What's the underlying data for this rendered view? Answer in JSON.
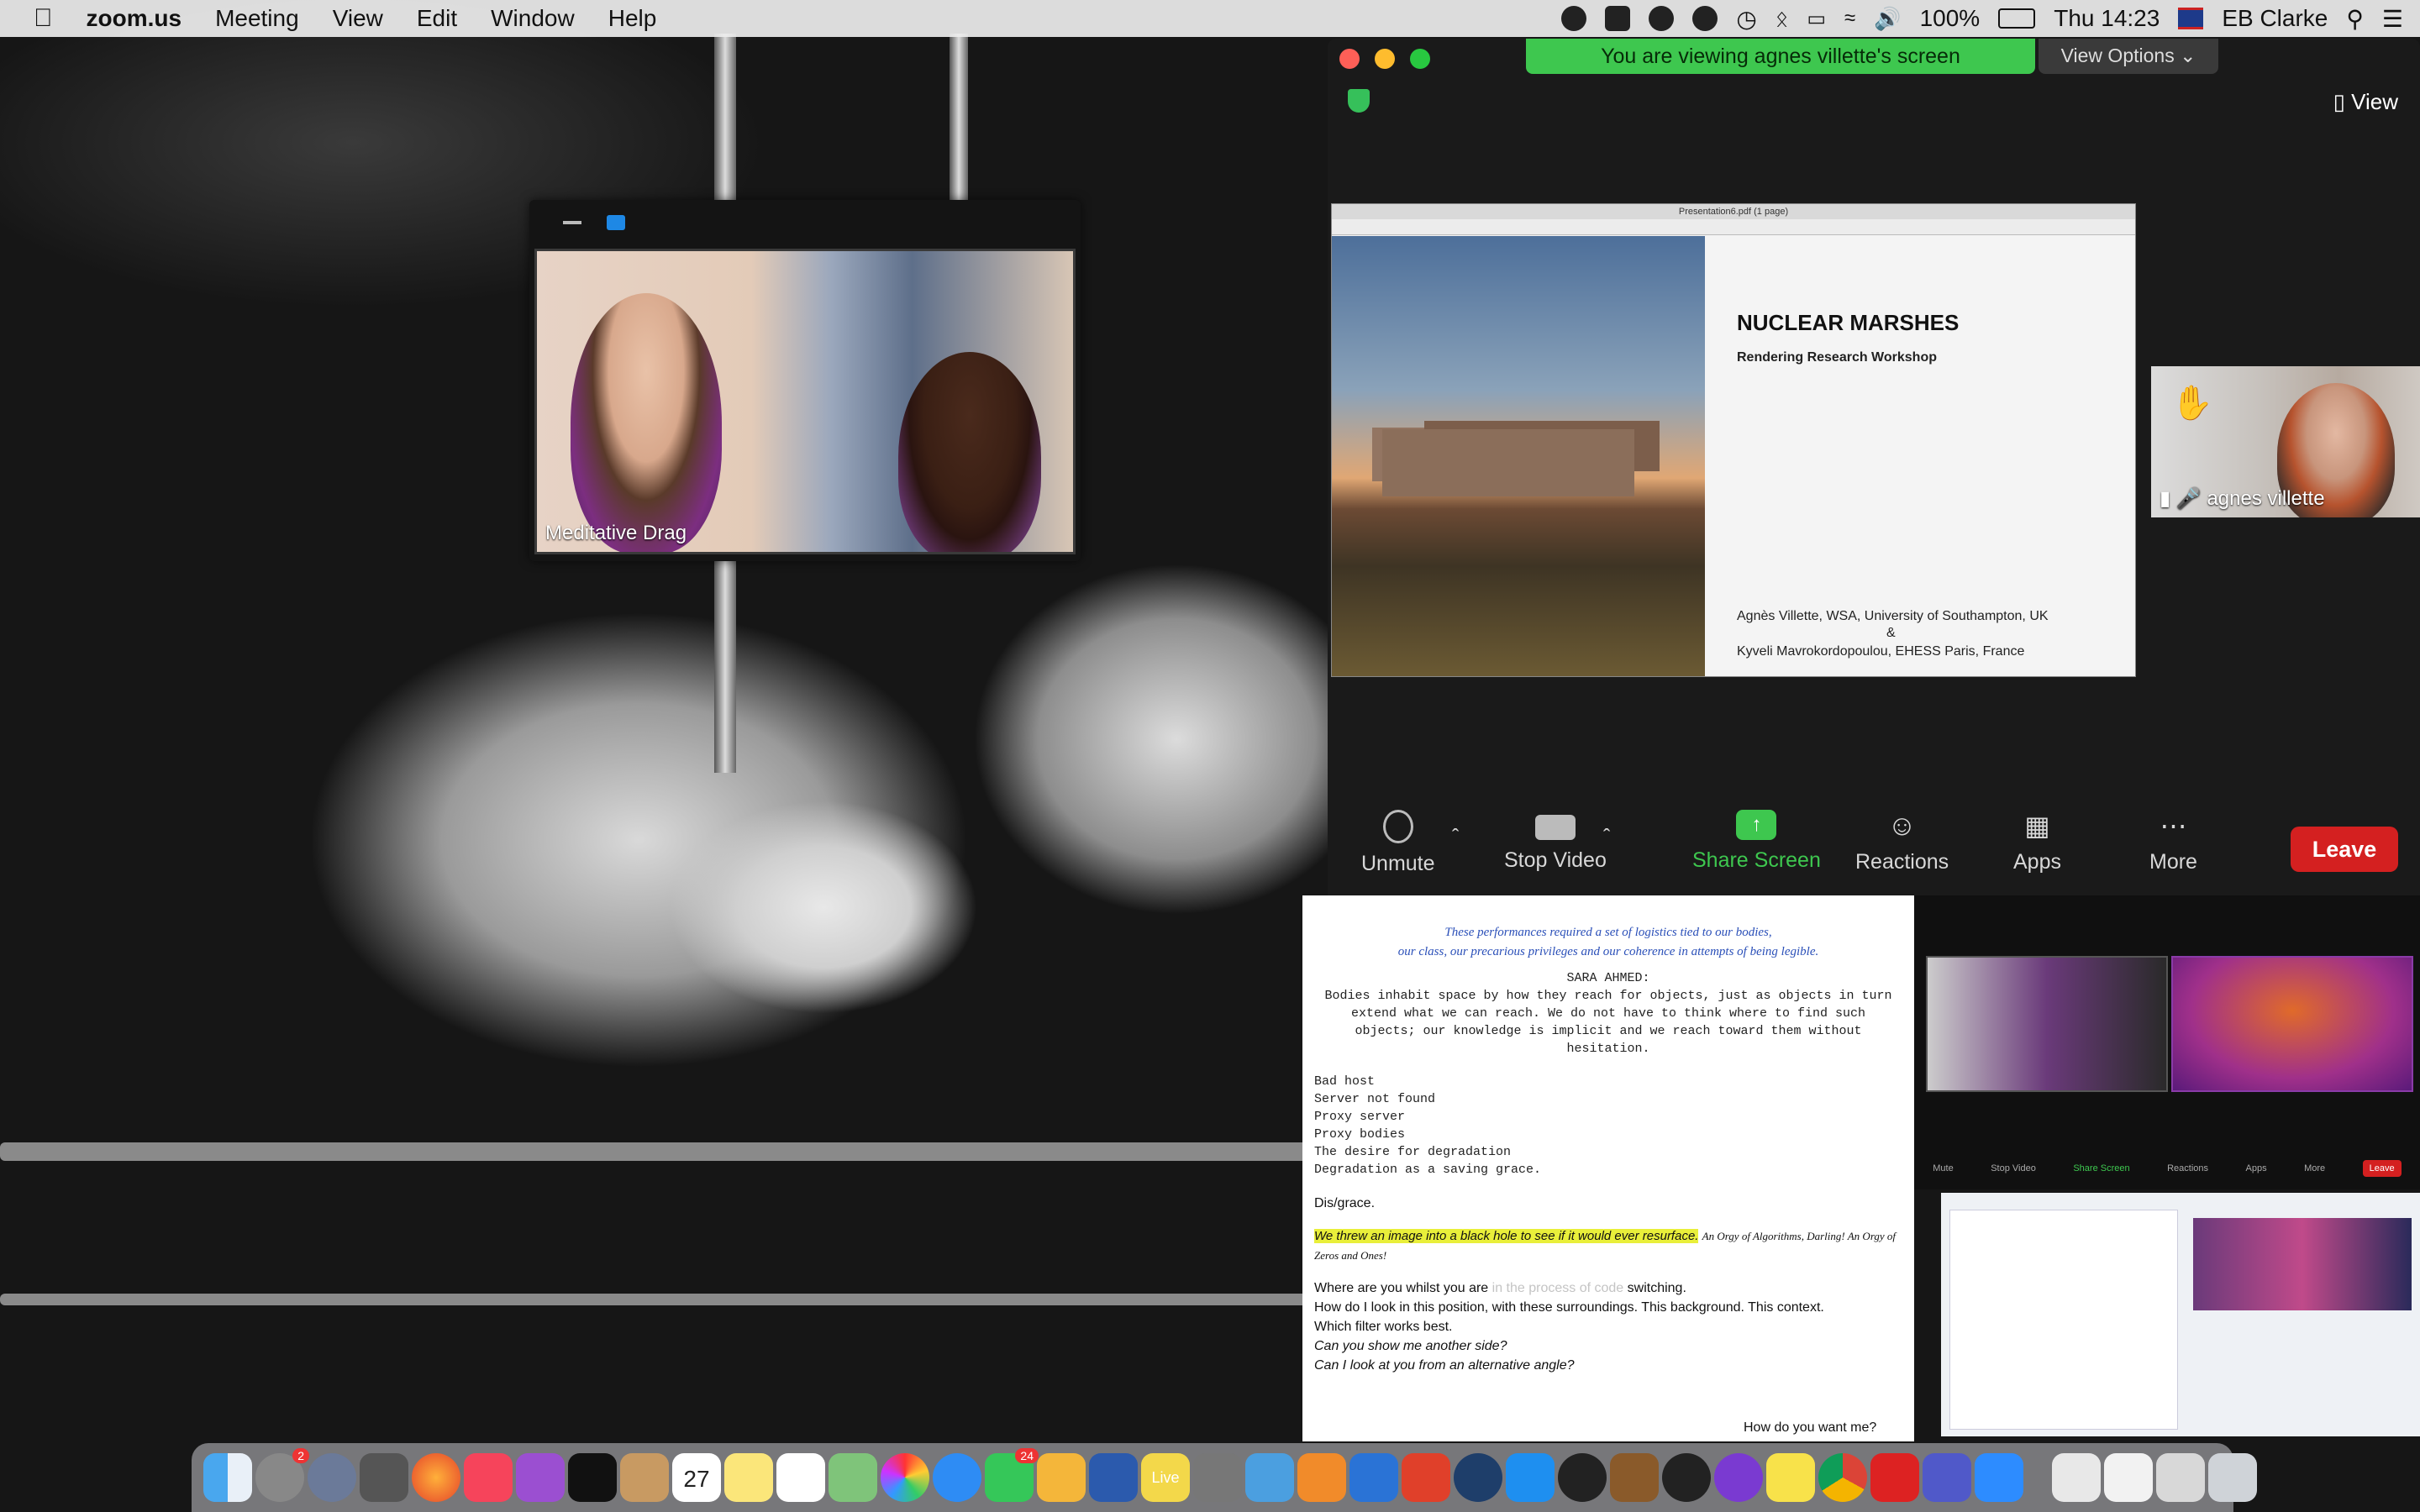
{
  "menubar": {
    "app_name": "zoom.us",
    "menus": [
      "Meeting",
      "View",
      "Edit",
      "Window",
      "Help"
    ],
    "battery": "100%",
    "clock": "Thu 14:23",
    "user": "EB Clarke"
  },
  "floating_video": {
    "participant_name": "Meditative Drag"
  },
  "zoom": {
    "viewing_banner": "You are viewing agnes villette's screen",
    "view_options": "View Options",
    "view_button": "View",
    "participant_name": "agnes villette",
    "controls": {
      "unmute": "Unmute",
      "stop_video": "Stop Video",
      "share_screen": "Share Screen",
      "reactions": "Reactions",
      "apps": "Apps",
      "more": "More",
      "leave": "Leave"
    },
    "share_color": "#3ec74f",
    "leave_color": "#d42020"
  },
  "slide": {
    "window_title": "Presentation6.pdf (1 page)",
    "title": "NUCLEAR MARSHES",
    "subtitle": "Rendering Research Workshop",
    "author_line1": "Agnès Villette, WSA, University of Southampton, UK",
    "ampersand": "&",
    "author_line2": "Kyveli Mavrokordopoulou, EHESS Paris, France"
  },
  "document": {
    "intro1": "These performances required a set of logistics tied to our bodies,",
    "intro2": "our class, our precarious privileges and our coherence in attempts of being legible.",
    "quote_heading": "SARA AHMED:",
    "quote": "Bodies inhabit space by how they reach for objects, just as objects in turn extend what we can reach. We do not have to think where to find such objects; our knowledge is implicit and we reach toward them without hesitation.",
    "list": [
      "Bad host",
      "Server not found",
      "Proxy server",
      "Proxy bodies",
      "The desire for degradation",
      "Degradation as a saving grace."
    ],
    "disgrace": "Dis/grace.",
    "highlight": "We threw an image into a black hole to see if it would ever resurface.",
    "citation": "An Orgy of Algorithms, Darling! An Orgy of Zeros and Ones!",
    "where_a": "Where are you whilst you are ",
    "where_ghost": "in the process of code",
    "where_b": " switching.",
    "line2": "How do I look in this position, with these surroundings. This background. This context.",
    "line3": "Which filter works best.",
    "line4": "Can you show me another side?",
    "line5": "Can I look at you from an alternative angle?",
    "footer": "How do you want me?"
  },
  "mini_zoom": {
    "controls": [
      "Mute",
      "Stop Video",
      "Share Screen",
      "Reactions",
      "Apps",
      "More"
    ],
    "leave": "Leave"
  },
  "dock": {
    "calendar_day": "27",
    "badges": {
      "settings": "2",
      "messages": "24"
    },
    "live_label": "Live"
  }
}
